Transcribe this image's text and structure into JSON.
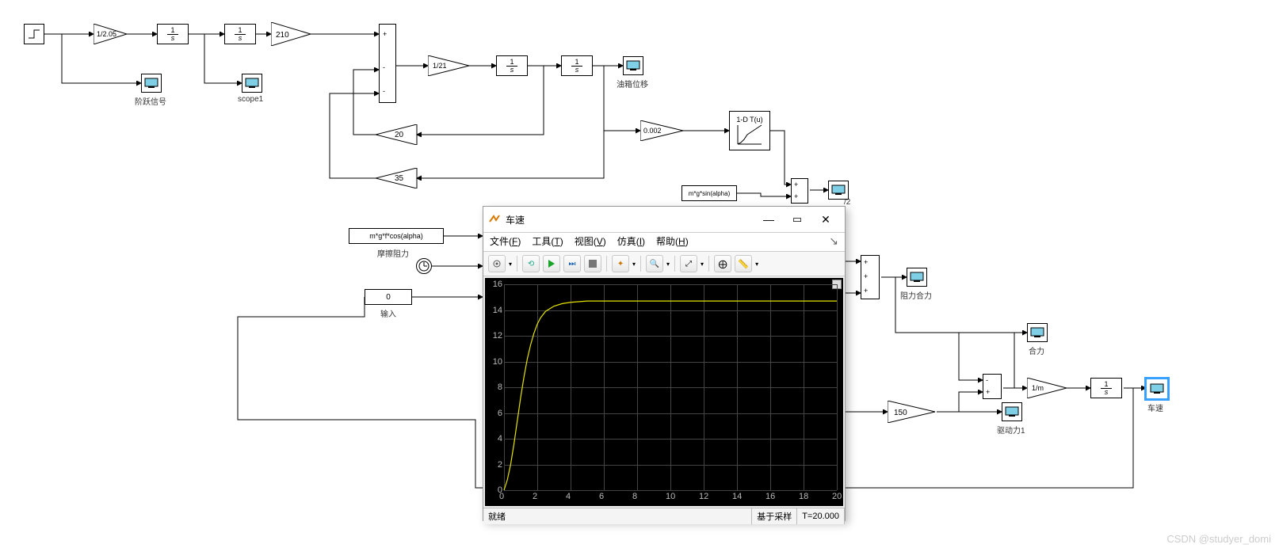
{
  "blocks": {
    "gain1": "1/2.05",
    "gain_int1": "1\ns",
    "gain_int2": "1\ns",
    "gain_210": "210",
    "gain_1_21": "1/21",
    "gain_int3": "1\ns",
    "gain_int4": "1\ns",
    "gain_20": "20",
    "gain_35": "35",
    "gain_0002": "0.002",
    "lut": "1-D T(u)",
    "sin_expr": "m*g*sin(alpha)",
    "cos_expr": "m*g*f*cos(alpha)",
    "const0": "0",
    "gain_150": "150",
    "gain_1m": "1/m",
    "gain_int5": "1\ns"
  },
  "labels": {
    "scope1": "scope1",
    "step": "阶跃信号",
    "friction": "摩擦阻力",
    "input": "输入",
    "yaxiang": "油箱位移",
    "sum2": "/2",
    "resist_sum": "阻力合力",
    "heli": "合力",
    "drive": "驱动力1",
    "speed": "车速"
  },
  "scope_window": {
    "title": "车速",
    "menu": {
      "file": "文件(F)",
      "tools": "工具(T)",
      "view": "视图(V)",
      "sim": "仿真(I)",
      "help": "帮助(H)"
    },
    "status_left": "就绪",
    "status_mode": "基于采样",
    "status_time": "T=20.000"
  },
  "chart_data": {
    "type": "line",
    "title": "车速",
    "xlabel": "",
    "ylabel": "",
    "xlim": [
      0,
      20
    ],
    "ylim": [
      0,
      16
    ],
    "x_ticks": [
      0,
      2,
      4,
      6,
      8,
      10,
      12,
      14,
      16,
      18,
      20
    ],
    "y_ticks": [
      0,
      2,
      4,
      6,
      8,
      10,
      12,
      14,
      16
    ],
    "series": [
      {
        "name": "车速",
        "color": "#e4e400",
        "x": [
          0,
          0.2,
          0.4,
          0.6,
          0.8,
          1,
          1.2,
          1.4,
          1.6,
          1.8,
          2,
          2.2,
          2.5,
          3,
          3.5,
          4,
          5,
          6,
          8,
          10,
          12,
          14,
          16,
          18,
          20
        ],
        "y": [
          0,
          0.8,
          2,
          3.6,
          5.4,
          7.2,
          8.8,
          10.2,
          11.3,
          12.2,
          12.9,
          13.4,
          13.9,
          14.3,
          14.5,
          14.6,
          14.7,
          14.7,
          14.7,
          14.7,
          14.7,
          14.7,
          14.7,
          14.7,
          14.7
        ]
      }
    ]
  },
  "watermark": "CSDN @studyer_domi"
}
